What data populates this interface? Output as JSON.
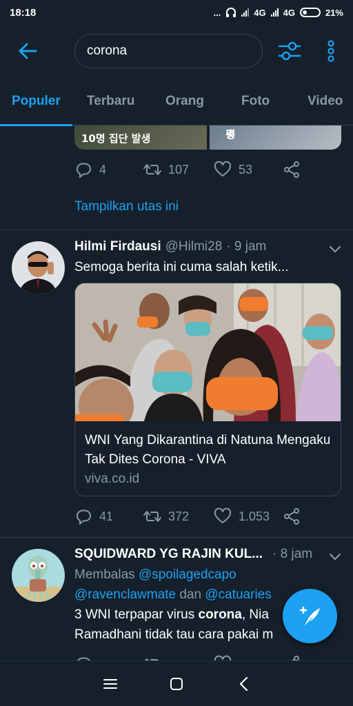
{
  "status_bar": {
    "time": "18:18",
    "dots": "...",
    "net1": "4G",
    "net2": "4G",
    "battery": "21%"
  },
  "header": {
    "search_value": "corona",
    "back_icon": "arrow-left-icon",
    "filter_icon": "sliders-icon",
    "more_icon": "more-vertical-icon"
  },
  "tabs": [
    {
      "label": "Populer",
      "active": true
    },
    {
      "label": "Terbaru",
      "active": false
    },
    {
      "label": "Orang",
      "active": false
    },
    {
      "label": "Foto",
      "active": false
    },
    {
      "label": "Video",
      "active": false
    }
  ],
  "prev_tweet": {
    "media_left_text": "10명 집단 발생",
    "media_right_text_a": "국내 총 ",
    "media_right_text_b": "32명",
    "reply_count": "4",
    "retweet_count": "107",
    "like_count": "53",
    "thread_link": "Tampilkan utas ini"
  },
  "tweet1": {
    "name": "Hilmi Firdausi",
    "handle": "@Hilmi28",
    "time": "· 9 jam",
    "text": "Semoga berita ini cuma salah ketik...",
    "card_title": "WNI Yang Dikarantina di Natuna Mengaku Tak Dites Corona - VIVA",
    "card_domain": "viva.co.id",
    "reply_count": "41",
    "retweet_count": "372",
    "like_count": "1.053"
  },
  "tweet2": {
    "name": "SQUIDWARD YG RAJIN KUL...",
    "time": "· 8 jam",
    "reply_prefix": "Membalas ",
    "reply_to_1": "@spoilagedcapo",
    "reply_to_2": "@ravenclawmate",
    "reply_and": " dan ",
    "reply_to_3": "@catuaries",
    "text_a": "3 WNI terpapar virus ",
    "text_bold": "corona",
    "text_b": ", Nia",
    "text_line2": "Ramadhani tidak tau cara pakai m"
  },
  "colors": {
    "background": "#15202b",
    "accent": "#1da1f2",
    "muted": "#8899a6",
    "divider": "#2f3b47"
  }
}
